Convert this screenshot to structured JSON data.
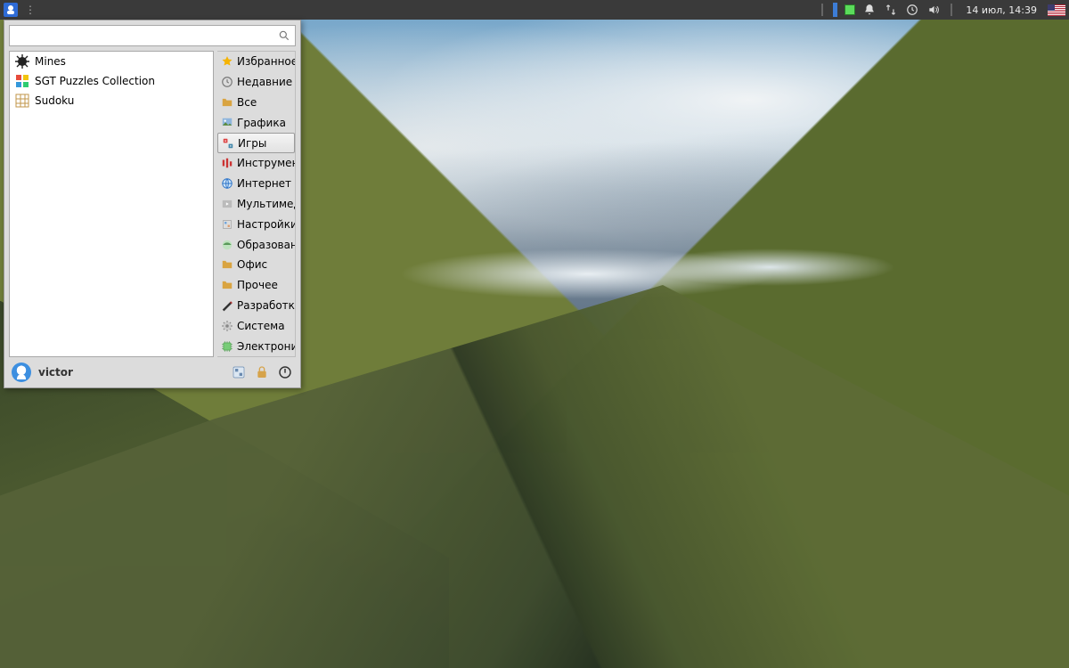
{
  "panel": {
    "datetime": "14 июл, 14:39"
  },
  "menu": {
    "search_placeholder": "",
    "apps": [
      {
        "label": "Mines",
        "icon": "mine"
      },
      {
        "label": "SGT Puzzles Collection",
        "icon": "puzzles"
      },
      {
        "label": "Sudoku",
        "icon": "sudoku"
      }
    ],
    "categories": [
      {
        "label": "Избранное",
        "icon": "star"
      },
      {
        "label": "Недавние",
        "icon": "clock"
      },
      {
        "label": "Все",
        "icon": "folder"
      },
      {
        "label": "Графика",
        "icon": "graphics"
      },
      {
        "label": "Игры",
        "icon": "games",
        "selected": true
      },
      {
        "label": "Инструменты",
        "icon": "tools"
      },
      {
        "label": "Интернет",
        "icon": "globe"
      },
      {
        "label": "Мультимедиа",
        "icon": "media"
      },
      {
        "label": "Настройки",
        "icon": "settings"
      },
      {
        "label": "Образование",
        "icon": "education"
      },
      {
        "label": "Офис",
        "icon": "office"
      },
      {
        "label": "Прочее",
        "icon": "other"
      },
      {
        "label": "Разработка",
        "icon": "dev"
      },
      {
        "label": "Система",
        "icon": "system"
      },
      {
        "label": "Электроника",
        "icon": "electronics"
      }
    ],
    "username": "victor"
  }
}
